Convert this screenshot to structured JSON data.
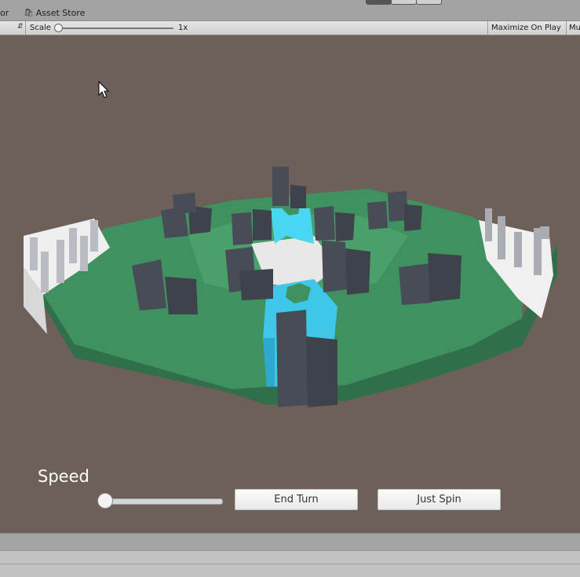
{
  "topbar": {
    "tab_left": "or",
    "asset_store": "Asset Store"
  },
  "toolbar": {
    "scale_label": "Scale",
    "scale_value": "1x",
    "maximize_on_play": "Maximize On Play",
    "mute_partial": "Mu"
  },
  "ui": {
    "speed_label": "Speed",
    "end_turn": "End Turn",
    "just_spin": "Just Spin",
    "speed_value": 0
  },
  "colors": {
    "background": "#6d6059",
    "grass": "#3f9160",
    "water": "#3fd1f0",
    "rock": "#474c56",
    "snow": "#eeeeee"
  }
}
